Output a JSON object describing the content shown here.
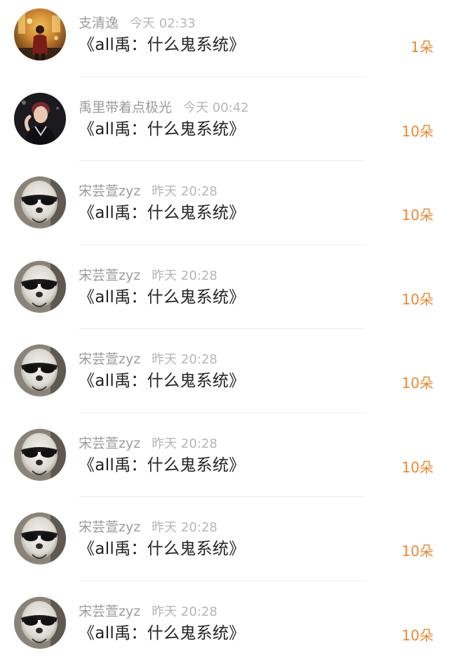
{
  "colors": {
    "accent": "#f0872f",
    "meta_text": "#a9a9a9",
    "title_text": "#222222",
    "divider": "#f0f0f0"
  },
  "rows": [
    {
      "avatar": "avatar-photo-street",
      "name": "支清逸",
      "time": "今天 02:33",
      "title": "《all禹：什么鬼系统》",
      "count": "1朵"
    },
    {
      "avatar": "avatar-photo-person",
      "name": "禹里带着点极光",
      "time": "今天 00:42",
      "title": "《all禹：什么鬼系统》",
      "count": "10朵"
    },
    {
      "avatar": "avatar-dog-sunglasses",
      "name": "宋芸萱zyz",
      "time": "昨天 20:28",
      "title": "《all禹：什么鬼系统》",
      "count": "10朵"
    },
    {
      "avatar": "avatar-dog-sunglasses",
      "name": "宋芸萱zyz",
      "time": "昨天 20:28",
      "title": "《all禹：什么鬼系统》",
      "count": "10朵"
    },
    {
      "avatar": "avatar-dog-sunglasses",
      "name": "宋芸萱zyz",
      "time": "昨天 20:28",
      "title": "《all禹：什么鬼系统》",
      "count": "10朵"
    },
    {
      "avatar": "avatar-dog-sunglasses",
      "name": "宋芸萱zyz",
      "time": "昨天 20:28",
      "title": "《all禹：什么鬼系统》",
      "count": "10朵"
    },
    {
      "avatar": "avatar-dog-sunglasses",
      "name": "宋芸萱zyz",
      "time": "昨天 20:28",
      "title": "《all禹：什么鬼系统》",
      "count": "10朵"
    },
    {
      "avatar": "avatar-dog-sunglasses",
      "name": "宋芸萱zyz",
      "time": "昨天 20:28",
      "title": "《all禹：什么鬼系统》",
      "count": "10朵"
    }
  ]
}
